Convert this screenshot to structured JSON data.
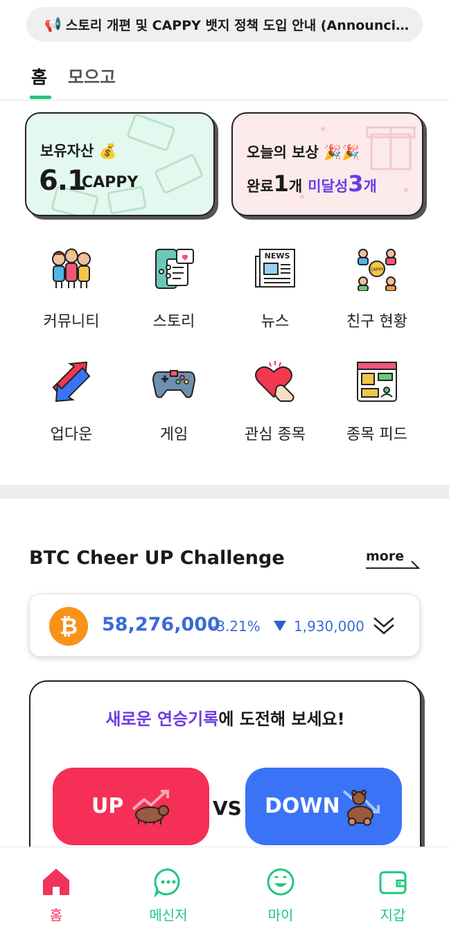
{
  "announcement": {
    "icon": "megaphone-icon",
    "icon_glyph": "📢",
    "text": "스토리 개편 및 CAPPY 뱃지 정책 도입 안내 (Announcing…"
  },
  "tabs": [
    {
      "label": "홈",
      "active": true
    },
    {
      "label": "모으고",
      "active": false
    }
  ],
  "asset_card": {
    "label": "보유자산",
    "icon_glyph": "💰",
    "value": "6.1",
    "unit": "CAPPY"
  },
  "reward_card": {
    "title": "오늘의 보상",
    "icon_glyph": "🎉🎉",
    "done_label": "완료",
    "done_count": "1",
    "done_unit": "개",
    "pending_label": "미달성",
    "pending_count": "3",
    "pending_unit": "개"
  },
  "menu": [
    {
      "label": "커뮤니티",
      "icon": "community-icon"
    },
    {
      "label": "스토리",
      "icon": "story-icon"
    },
    {
      "label": "뉴스",
      "icon": "news-icon"
    },
    {
      "label": "친구 현황",
      "icon": "friends-icon"
    },
    {
      "label": "업다운",
      "icon": "updown-icon"
    },
    {
      "label": "게임",
      "icon": "game-icon"
    },
    {
      "label": "관심 종목",
      "icon": "heart-icon"
    },
    {
      "label": "종목 피드",
      "icon": "feed-icon"
    }
  ],
  "challenge": {
    "title": "BTC Cheer UP Challenge",
    "more": "more",
    "coin_symbol": "₿",
    "price": "58,276,000",
    "change_pct": "-3.21%",
    "change_amount": "1,930,000",
    "prompt_accent": "새로운 연승기록",
    "prompt_rest": "에 도전해 보세요!",
    "up_label": "UP",
    "vs_label": "VS",
    "down_label": "DOWN"
  },
  "bottom_nav": [
    {
      "label": "홈",
      "icon": "home-icon",
      "active": true
    },
    {
      "label": "메신저",
      "icon": "chat-icon",
      "active": false
    },
    {
      "label": "마이",
      "icon": "smile-icon",
      "active": false
    },
    {
      "label": "지갑",
      "icon": "wallet-icon",
      "active": false
    }
  ],
  "colors": {
    "accent_green": "#1ec77e",
    "accent_pink": "#f0335a",
    "purple": "#6a3be6",
    "price_blue": "#3a6bd8",
    "up_red": "#f62f56",
    "down_blue": "#3a73f6",
    "btc_orange": "#f7931a"
  }
}
